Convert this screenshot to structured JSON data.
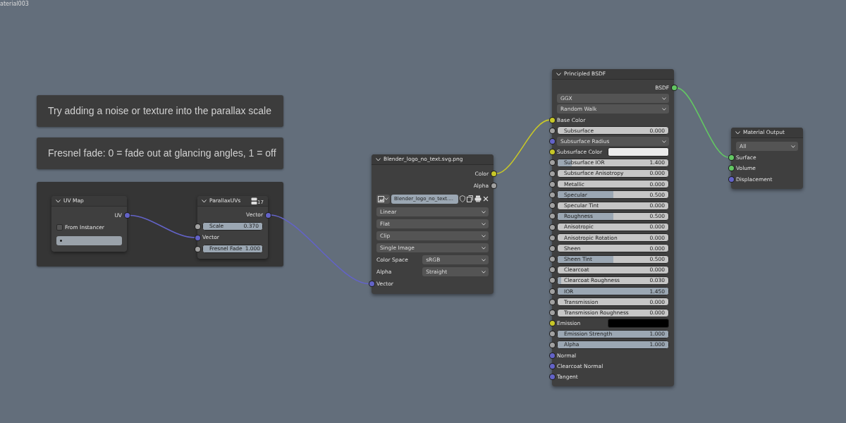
{
  "editor": {
    "title": "aterial003"
  },
  "frames": [
    {
      "kind": "note",
      "text": "Try adding a noise or texture into the parallax scale"
    },
    {
      "kind": "note",
      "text": "Fresnel fade: 0 = fade out at glancing angles, 1 = off"
    },
    {
      "kind": "group"
    }
  ],
  "nodes": [
    {
      "title": "UV Map",
      "rows": [
        {
          "kind": "output",
          "label": "UV",
          "color": "#6363c7"
        },
        {
          "kind": "checkbox",
          "label": "From Instancer",
          "checked": false
        },
        {
          "kind": "search"
        }
      ]
    },
    {
      "title": "ParallaxUVs",
      "users": "17",
      "rows": [
        {
          "kind": "output",
          "label": "Vector",
          "color": "#6363c7"
        },
        {
          "kind": "number",
          "label": "Scale",
          "value": "0.370",
          "color": "#a1a1a1"
        },
        {
          "kind": "input",
          "label": "Vector",
          "color": "#6363c7"
        },
        {
          "kind": "number",
          "label": "Fresnel Fade",
          "value": "1.000",
          "color": "#a1a1a1"
        }
      ]
    },
    {
      "title": "Blender_logo_no_text.svg.png",
      "rows": [
        {
          "kind": "output",
          "label": "Color",
          "color": "#c7c729"
        },
        {
          "kind": "output",
          "label": "Alpha",
          "color": "#a1a1a1"
        },
        {
          "kind": "image",
          "value": "Blender_logo_no_text...."
        },
        {
          "kind": "dropdown",
          "value": "Linear"
        },
        {
          "kind": "dropdown",
          "value": "Flat"
        },
        {
          "kind": "dropdown",
          "value": "Clip"
        },
        {
          "kind": "dropdown",
          "value": "Single Image"
        },
        {
          "kind": "labeled_dropdown",
          "label": "Color Space",
          "value": "sRGB"
        },
        {
          "kind": "labeled_dropdown",
          "label": "Alpha",
          "value": "Straight"
        },
        {
          "kind": "input",
          "label": "Vector",
          "color": "#6363c7"
        }
      ]
    },
    {
      "title": "Principled BSDF",
      "rows": [
        {
          "kind": "output",
          "label": "BSDF",
          "color": "#63c763"
        },
        {
          "kind": "dropdown",
          "value": "GGX"
        },
        {
          "kind": "dropdown",
          "value": "Random Walk"
        },
        {
          "kind": "input",
          "label": "Base Color",
          "color": "#c7c729"
        },
        {
          "kind": "slider",
          "label": "Subsurface",
          "value": "0.000",
          "level": 0,
          "color": "#a1a1a1"
        },
        {
          "kind": "dropdown",
          "value": "Subsurface Radius",
          "color": "#6363c7"
        },
        {
          "kind": "swatch",
          "label": "Subsurface Color",
          "color": "#ebebeb"
        },
        {
          "kind": "slider",
          "label": "Subsurface IOR",
          "value": "1.400",
          "level": 0.13,
          "color": "#a1a1a1"
        },
        {
          "kind": "slider",
          "label": "Subsurface Anisotropy",
          "value": "0.000",
          "level": 0,
          "color": "#a1a1a1"
        },
        {
          "kind": "slider",
          "label": "Metallic",
          "value": "0.000",
          "level": 0,
          "color": "#a1a1a1"
        },
        {
          "kind": "slider",
          "label": "Specular",
          "value": "0.500",
          "level": 0.5,
          "color": "#a1a1a1"
        },
        {
          "kind": "slider",
          "label": "Specular Tint",
          "value": "0.000",
          "level": 0,
          "color": "#a1a1a1"
        },
        {
          "kind": "slider",
          "label": "Roughness",
          "value": "0.500",
          "level": 0.5,
          "color": "#a1a1a1"
        },
        {
          "kind": "slider",
          "label": "Anisotropic",
          "value": "0.000",
          "level": 0,
          "color": "#a1a1a1"
        },
        {
          "kind": "slider",
          "label": "Anisotropic Rotation",
          "value": "0.000",
          "level": 0,
          "color": "#a1a1a1"
        },
        {
          "kind": "slider",
          "label": "Sheen",
          "value": "0.000",
          "level": 0,
          "color": "#a1a1a1"
        },
        {
          "kind": "slider",
          "label": "Sheen Tint",
          "value": "0.500",
          "level": 0.5,
          "color": "#a1a1a1"
        },
        {
          "kind": "slider",
          "label": "Clearcoat",
          "value": "0.000",
          "level": 0,
          "color": "#a1a1a1"
        },
        {
          "kind": "slider",
          "label": "Clearcoat Roughness",
          "value": "0.030",
          "level": 0.03,
          "color": "#a1a1a1"
        },
        {
          "kind": "number",
          "label": "IOR",
          "value": "1.450",
          "color": "#a1a1a1"
        },
        {
          "kind": "slider",
          "label": "Transmission",
          "value": "0.000",
          "level": 0,
          "color": "#a1a1a1"
        },
        {
          "kind": "slider",
          "label": "Transmission Roughness",
          "value": "0.000",
          "level": 0,
          "color": "#a1a1a1"
        },
        {
          "kind": "swatch",
          "label": "Emission",
          "color": "#000000"
        },
        {
          "kind": "number",
          "label": "Emission Strength",
          "value": "1.000",
          "color": "#a1a1a1"
        },
        {
          "kind": "slider",
          "label": "Alpha",
          "value": "1.000",
          "level": 1,
          "color": "#a1a1a1"
        },
        {
          "kind": "input",
          "label": "Normal",
          "color": "#6363c7"
        },
        {
          "kind": "input",
          "label": "Clearcoat Normal",
          "color": "#6363c7"
        },
        {
          "kind": "input",
          "label": "Tangent",
          "color": "#6363c7"
        }
      ]
    },
    {
      "title": "Material Output",
      "rows": [
        {
          "kind": "dropdown",
          "value": "All"
        },
        {
          "kind": "input",
          "label": "Surface",
          "color": "#63c763"
        },
        {
          "kind": "input",
          "label": "Volume",
          "color": "#63c763"
        },
        {
          "kind": "input",
          "label": "Displacement",
          "color": "#6363c7"
        }
      ]
    }
  ]
}
